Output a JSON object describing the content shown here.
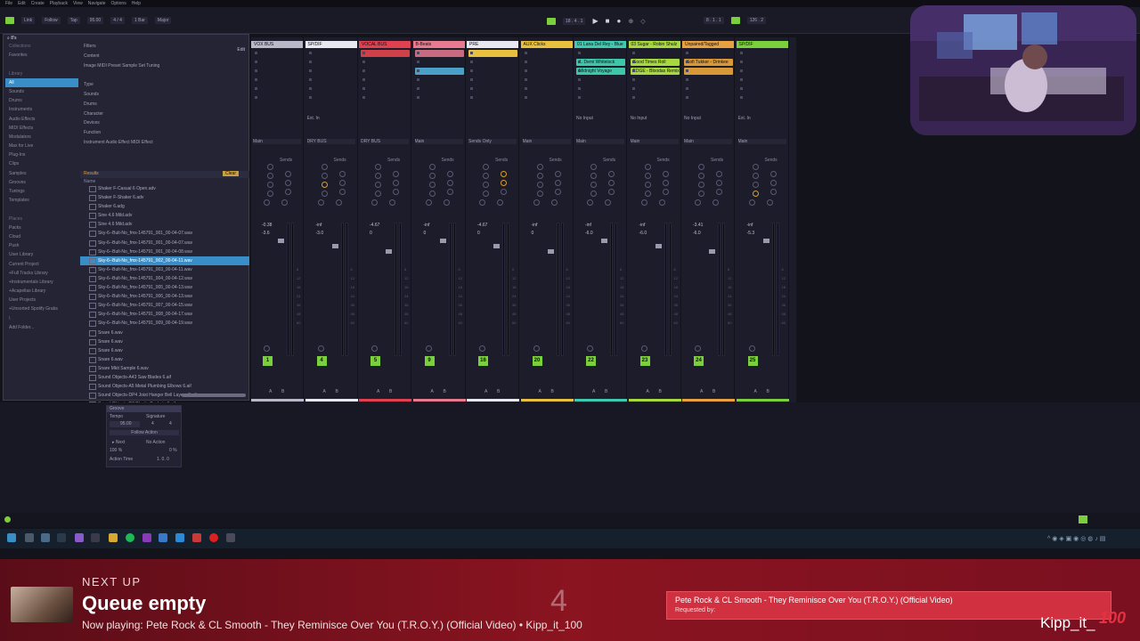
{
  "menu": [
    "File",
    "Edit",
    "Create",
    "Playback",
    "View",
    "Navigate",
    "Options",
    "Help"
  ],
  "transport": {
    "link": "Link",
    "follow": "Follow",
    "tap": "Tap",
    "tempo": "95.00",
    "signature": "4 / 4",
    "quant": "1 Bar",
    "key": "Major",
    "position": "18 . 4 . 1",
    "loop_start": "8 . 1 . 1",
    "loop_len": "126 . 2"
  },
  "browser": {
    "search": "8's",
    "side": [
      {
        "label": "Collections",
        "type": "hdr"
      },
      {
        "label": "Favorites"
      },
      {
        "label": ""
      },
      {
        "label": "Library",
        "type": "hdr"
      },
      {
        "label": "All",
        "active": true
      },
      {
        "label": "Sounds"
      },
      {
        "label": "Drums"
      },
      {
        "label": "Instruments"
      },
      {
        "label": "Audio Effects"
      },
      {
        "label": "MIDI Effects"
      },
      {
        "label": "Modulators"
      },
      {
        "label": "Max for Live"
      },
      {
        "label": "Plug-Ins"
      },
      {
        "label": "Clips"
      },
      {
        "label": "Samples"
      },
      {
        "label": "Grooves"
      },
      {
        "label": "Tunings"
      },
      {
        "label": "Templates"
      },
      {
        "label": ""
      },
      {
        "label": "Places",
        "type": "hdr"
      },
      {
        "label": "Packs"
      },
      {
        "label": "Cloud"
      },
      {
        "label": "Push"
      },
      {
        "label": "User Library"
      },
      {
        "label": "Current Project"
      },
      {
        "label": "+Full Tracks Library"
      },
      {
        "label": "+Instrumentals Library"
      },
      {
        "label": "+Acapellas Library"
      },
      {
        "label": "User Projects"
      },
      {
        "label": "+Unsorted Spotify Grabs"
      },
      {
        "label": "\\"
      },
      {
        "label": "Add Folder..."
      }
    ],
    "filters": [
      "Filters",
      "Content",
      "Image  MIDI  Preset  Sample  Set  Tuning",
      "",
      "Type",
      "Sounds",
      "Drums",
      "Character",
      "Devices",
      "Function",
      "Instrument  Audio Effect  MIDI Effect"
    ],
    "edit": "Edit",
    "results_label": "Results",
    "clear_label": "Clear",
    "name_col": "Name",
    "files": [
      "Shaker F-Casual 6 Open.adv",
      "Shaker F-Shaker 6.adv",
      "Shaker 6.adg",
      "Sine 4.6 Mild.adv",
      "Sine 4.6 Mild.adv",
      "Sky-6--Bult-No_fmx-145791_001_00-04-07.wav",
      "Sky-6--Bult-No_fmx-145791_001_00-04-07.wav",
      "Sky-6--Bult-No_fmx-145791_001_00-04-08.wav",
      "Sky-6--Bult-No_fmx-145791_002_00-04-11.wav",
      "Sky-6--Bult-No_fmx-145791_003_00-04-11.wav",
      "Sky-6--Bult-No_fmx-145791_004_00-04-12.wav",
      "Sky-6--Bult-No_fmx-145791_005_00-04-13.wav",
      "Sky-6--Bult-No_fmx-145791_006_00-04-13.wav",
      "Sky-6--Bult-No_fmx-145791_007_00-04-15.wav",
      "Sky-6--Bult-No_fmx-145791_008_00-04-17.wav",
      "Sky-6--Bult-No_fmx-145791_009_00-04-19.wav",
      "Snare 6.wav",
      "Snare 6.wav",
      "Snare 6.wav",
      "Snare 6.wav",
      "Snare Mkit Sample 6.wav",
      "Sound Objects-A43 Saw Blades 6.aif",
      "Sound Objects-A5 Metal Plumbing Elbows 6.aif",
      "Sound Objects-DP4 Joist Hanger Bell Layers 6.aif",
      "Sound Objects-D2 Plastic Baskets 6.aif",
      "Sound Objects-D5 Metal Plumbing Elbows 6.aif",
      "Sound Objects-EX5 Plastic Baskets 6.aif",
      "Sound Objects-F47 ARII Pinos 6.aif"
    ],
    "selected_index": 8
  },
  "tracks": [
    {
      "name": "VOX BUS",
      "color": "#b8b8c8",
      "clips": [],
      "routing_in": "",
      "out": "Main",
      "vol": "-0.38",
      "pan": "-3.6",
      "num": "1",
      "knobs": []
    },
    {
      "name": "SP/DIF",
      "color": "#e8e8f0",
      "clips": [],
      "routing_in": "Ext. In",
      "out": "DRY BUS",
      "vol": "-inf",
      "pan": "-3.0",
      "num": "4",
      "knobs": [
        2
      ]
    },
    {
      "name": "VOCAL BUS",
      "color": "#e04050",
      "clips": [
        {
          "label": "",
          "color": "#d04048",
          "row": 0
        }
      ],
      "routing_in": "",
      "out": "DRY BUS",
      "vol": "-4.67",
      "pan": "0",
      "num": "5",
      "knobs": []
    },
    {
      "name": "B-Beats",
      "color": "#e87a90",
      "clips": [
        {
          "label": "",
          "color": "#c86a80",
          "row": 0
        },
        {
          "label": "",
          "color": "#4aa0c8",
          "row": 2
        }
      ],
      "routing_in": "",
      "out": "Main",
      "vol": "-inf",
      "pan": "0",
      "num": "9",
      "knobs": []
    },
    {
      "name": "PRE",
      "color": "#e8e8f0",
      "clips": [
        {
          "label": "",
          "color": "#e8c040",
          "row": 0
        }
      ],
      "routing_in": "",
      "out": "Sends Only",
      "vol": "-4.67",
      "pan": "0",
      "num": "16",
      "knobs": [
        4,
        5
      ]
    },
    {
      "name": "AUX Clicks",
      "color": "#e8c040",
      "clips": [],
      "routing_in": "",
      "out": "Main",
      "vol": "-inf",
      "pan": "0",
      "num": "20",
      "knobs": []
    },
    {
      "name": "01 Lana Del Rey - Blue",
      "color": "#40c8b0",
      "clips": [
        {
          "label": "1. Demi Whitelock",
          "color": "#3cc8a8",
          "row": 1
        },
        {
          "label": "Midnight Voyage",
          "color": "#3cc8a8",
          "row": 2
        }
      ],
      "routing_in": "No Input",
      "out": "Main",
      "vol": "-inf",
      "pan": "-6.0",
      "num": "22",
      "knobs": []
    },
    {
      "name": "03 Sugar - Robin Shulz",
      "color": "#a8d840",
      "clips": [
        {
          "label": "Good Times Roll",
          "color": "#a8d840",
          "row": 1
        },
        {
          "label": "EDGE - Bloodas Remix",
          "color": "#a8d840",
          "row": 2
        }
      ],
      "routing_in": "No Input",
      "out": "Main",
      "vol": "-inf",
      "pan": "-6.0",
      "num": "23",
      "knobs": []
    },
    {
      "name": "Unpaired/Tagged",
      "color": "#e8a040",
      "clips": [
        {
          "label": "Sofi Tukker - Drinkee",
          "color": "#d89838",
          "row": 1
        },
        {
          "label": "",
          "color": "#d89838",
          "row": 2
        }
      ],
      "routing_in": "No Input",
      "out": "Main",
      "vol": "-3.41",
      "pan": "-6.0",
      "num": "24",
      "knobs": []
    },
    {
      "name": "SP/DIF",
      "color": "#7ccf3c",
      "clips": [],
      "routing_in": "Ext. In",
      "out": "Main",
      "vol": "-inf",
      "pan": "-5.3",
      "num": "25",
      "knobs": [
        3
      ]
    }
  ],
  "mixer_labels": {
    "sends": "Sends",
    "track_in": "Track In",
    "in": "In",
    "auto": "Auto",
    "off": "Off",
    "a": "A",
    "b": "B",
    "ext_ch": "9/50"
  },
  "clip_props": {
    "title": "Groove",
    "tempo_label": "Tempo",
    "sig_label": "Signature",
    "tempo": "95.00",
    "sig_num": "4",
    "sig_den": "4",
    "follow_label": "Follow Action",
    "next": "Next",
    "no_action": "No Action",
    "chance_a": "100 %",
    "chance_b": "0 %",
    "action_time_label": "Action Time",
    "action_time": "1.  0.  0"
  },
  "overlay": {
    "next_up": "NEXT UP",
    "queue": "Queue empty",
    "now_playing": "Now playing: Pete Rock & CL Smooth - They Reminisce Over You (T.R.O.Y.) (Official Video) • Kipp_it_100",
    "count": "4",
    "request_title": "Pete Rock & CL Smooth - They Reminisce Over You (T.R.O.Y.) (Official Video)",
    "requested_by": "Requested by:",
    "brand": "Kipp_it_",
    "brand_suffix": "100"
  },
  "colors": {
    "accent": "#7ccf3c",
    "selection": "#3a8ec8",
    "overlay_red": "#8a1420",
    "request_red": "#d03040"
  }
}
